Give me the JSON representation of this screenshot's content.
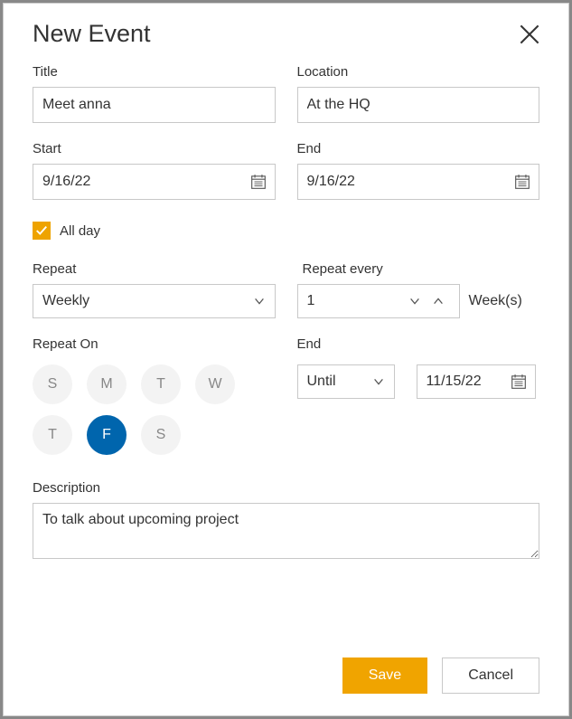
{
  "dialog": {
    "title": "New Event"
  },
  "form": {
    "title": {
      "label": "Title",
      "value": "Meet anna"
    },
    "location": {
      "label": "Location",
      "value": "At the HQ"
    },
    "start": {
      "label": "Start",
      "value": "9/16/22"
    },
    "end": {
      "label": "End",
      "value": "9/16/22"
    },
    "allday": {
      "label": "All day",
      "checked": true
    },
    "repeat": {
      "label": "Repeat",
      "value": "Weekly"
    },
    "repeat_every": {
      "label": "Repeat every",
      "value": "1",
      "unit": "Week(s)"
    },
    "repeat_on": {
      "label": "Repeat On",
      "days": [
        {
          "letter": "S",
          "active": false
        },
        {
          "letter": "M",
          "active": false
        },
        {
          "letter": "T",
          "active": false
        },
        {
          "letter": "W",
          "active": false
        },
        {
          "letter": "T",
          "active": false
        },
        {
          "letter": "F",
          "active": true
        },
        {
          "letter": "S",
          "active": false
        }
      ]
    },
    "repeat_end": {
      "label": "End",
      "mode": "Until",
      "date": "11/15/22"
    },
    "description": {
      "label": "Description",
      "value": "To talk about upcoming project"
    }
  },
  "buttons": {
    "save": "Save",
    "cancel": "Cancel"
  }
}
